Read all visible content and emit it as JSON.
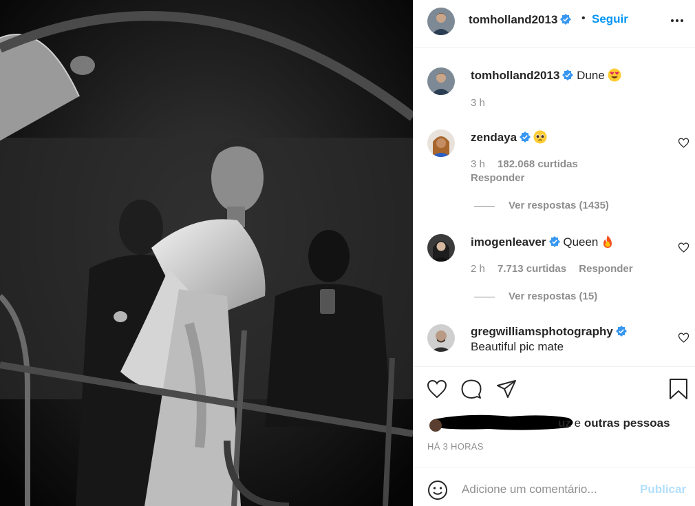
{
  "post": {
    "author": "tomholland2013",
    "follow_label": "Seguir",
    "dot": "•",
    "caption_text": "Dune",
    "caption_time": "3 h"
  },
  "comments": [
    {
      "username": "zendaya",
      "text": "",
      "emoji": "pleading-face",
      "time": "3 h",
      "likes": "182.068 curtidas",
      "reply": "Responder",
      "view_replies": "Ver respostas (1435)"
    },
    {
      "username": "imogenleaver",
      "text": "Queen",
      "emoji": "fire",
      "time": "2 h",
      "likes": "7.713 curtidas",
      "reply": "Responder",
      "view_replies": "Ver respostas (15)"
    },
    {
      "username": "gregwilliamsphotography",
      "text": "Beautiful pic mate"
    }
  ],
  "liked_by": {
    "visible_name_suffix": "uz",
    "connector": "e",
    "others": "outras pessoas"
  },
  "posted_ago": "HÁ 3 HORAS",
  "comment_box": {
    "placeholder": "Adicione um comentário...",
    "publish_label": "Publicar"
  },
  "icons": {
    "verified": "verified-badge-icon",
    "more": "more-options-icon",
    "like": "heart-icon",
    "comment": "comment-bubble-icon",
    "share": "paper-plane-icon",
    "save": "bookmark-icon",
    "emoji_picker": "smiley-icon"
  },
  "colors": {
    "accent": "#0095f6",
    "verified": "#3897f0",
    "muted": "#8e8e8e",
    "publish_disabled": "#b2dffc"
  }
}
